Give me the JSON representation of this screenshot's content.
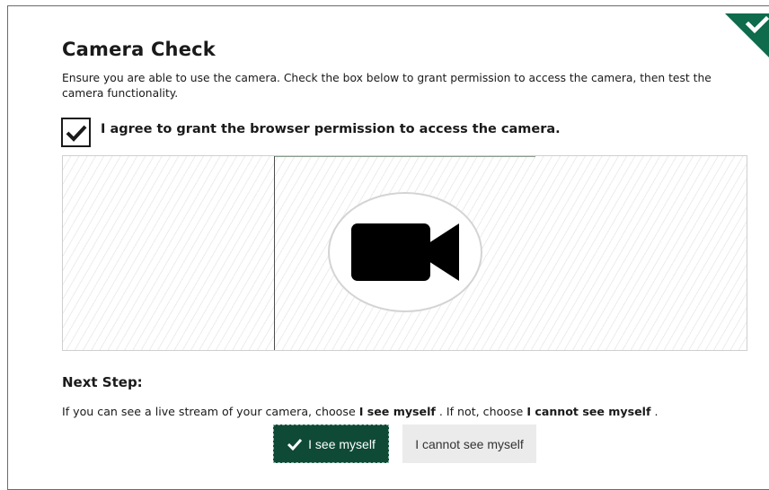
{
  "colors": {
    "accent": "#0f4a37",
    "corner_badge": "#0e6b4b",
    "border": "#6b6b6b",
    "secondary_button_bg": "#ebebeb"
  },
  "page": {
    "title": "Camera Check",
    "description": "Ensure you are able to use the camera. Check the box below to grant permission to access the camera, then test the camera functionality."
  },
  "permission": {
    "checked": true,
    "label": "I agree to grant the browser permission to access the camera."
  },
  "preview": {
    "icon": "video-camera-icon"
  },
  "next_step": {
    "heading": "Next Step:",
    "instructions": {
      "part1": "If you can see a live stream of your camera, choose",
      "option_yes": "I see myself",
      "part2": ". If not, choose",
      "option_no": "I cannot see myself",
      "part3": "."
    }
  },
  "buttons": {
    "see_myself": "I see myself",
    "cannot_see_myself": "I cannot see myself"
  },
  "status": {
    "icon": "checkmark-icon",
    "state": "complete"
  }
}
